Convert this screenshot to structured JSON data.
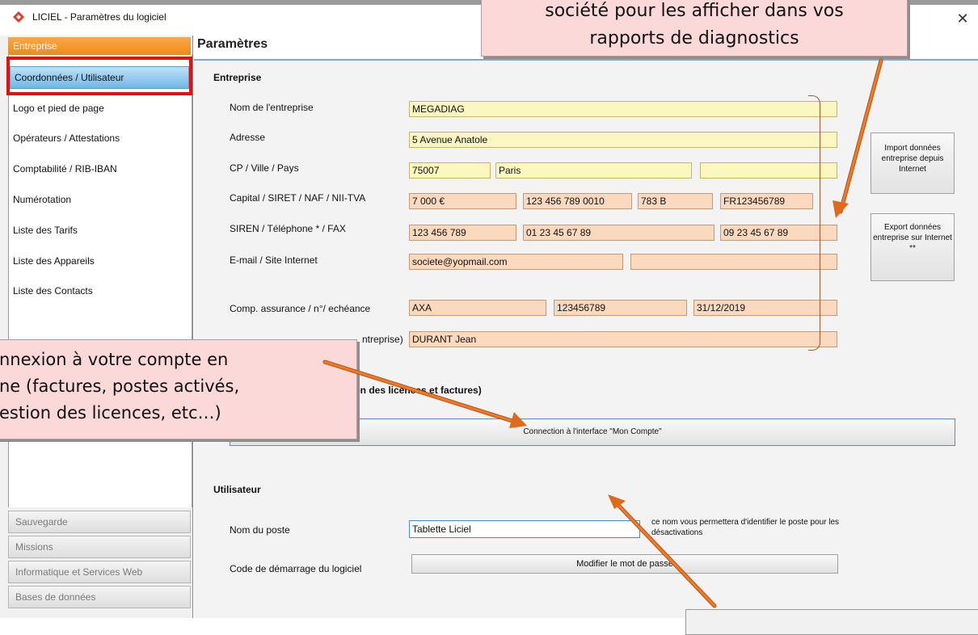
{
  "window": {
    "title": "LICIEL - Paramètres du logiciel",
    "close_glyph": "✕"
  },
  "sidebar": {
    "header": "Entreprise",
    "items": [
      {
        "label": "Coordonnées / Utilisateur"
      },
      {
        "label": "Logo et pied de page"
      },
      {
        "label": "Opérateurs / Attestations"
      },
      {
        "label": "Comptabilité / RIB-IBAN"
      },
      {
        "label": "Numérotation"
      },
      {
        "label": "Liste des Tarifs"
      },
      {
        "label": "Liste des Appareils"
      },
      {
        "label": "Liste des Contacts"
      }
    ],
    "bottom_groups": [
      "Sauvegarde",
      "Missions",
      "Informatique et Services Web",
      "Bases de données"
    ]
  },
  "main": {
    "title": "Paramètres",
    "entreprise": {
      "section": "Entreprise",
      "nom_label": "Nom de l'entreprise",
      "nom": "MEGADIAG",
      "adresse_label": "Adresse",
      "adresse": "5 Avenue Anatole",
      "cp_label": "CP / Ville / Pays",
      "cp": "75007",
      "ville": "Paris",
      "pays": "",
      "capital_label": "Capital / SIRET / NAF / NII-TVA",
      "capital": "7 000 €",
      "siret": "123 456 789 0010",
      "naf": "783 B",
      "tva": "FR123456789",
      "siren_label": "SIREN / Téléphone * / FAX",
      "siren": "123 456 789",
      "telephone": "01 23 45 67 89",
      "fax": "09 23 45 67 89",
      "email_label": "E-mail / Site Internet",
      "email": "societe@yopmail.com",
      "site": "",
      "assurance_label": "Comp. assurance / n°/ echéance",
      "assurance": "AXA",
      "assurance_num": "123456789",
      "assurance_date": "31/12/2019",
      "gerant_label_visible": "ntreprise)",
      "gerant": "DURANT Jean",
      "import_btn": "Import données entreprise depuis Internet",
      "export_btn": "Export données entreprise sur Internet **"
    },
    "compte": {
      "section_visible": "ion des licences et factures)",
      "button": "Connection à l'interface \"Mon Compte\""
    },
    "utilisateur": {
      "section": "Utilisateur",
      "poste_label": "Nom du poste",
      "poste": "Tablette Liciel",
      "poste_hint": "ce nom vous permettera d'identifier le poste pour les désactivations",
      "code_label": "Code de démarrage du logiciel",
      "code_btn": "Modifier le mot de passe"
    }
  },
  "callouts": {
    "top_line1": "société pour les afficher dans vos",
    "top_line2": "rapports de diagnostics",
    "left_line1": "nnexion à votre compte en",
    "left_line2": "ne (factures, postes activés,",
    "left_line3": "estion des licences, etc…)"
  },
  "colors": {
    "accent_orange": "#f08a18",
    "selection_blue": "#6fb8e8",
    "highlight_red": "#e31010",
    "field_yellow": "#fbf7c0",
    "field_peach": "#fbd9bf",
    "callout_pink": "#fbd9d9",
    "arrow_orange": "#e06a1a"
  },
  "icons": {
    "app": "liciel-logo-icon",
    "close": "close-icon"
  }
}
